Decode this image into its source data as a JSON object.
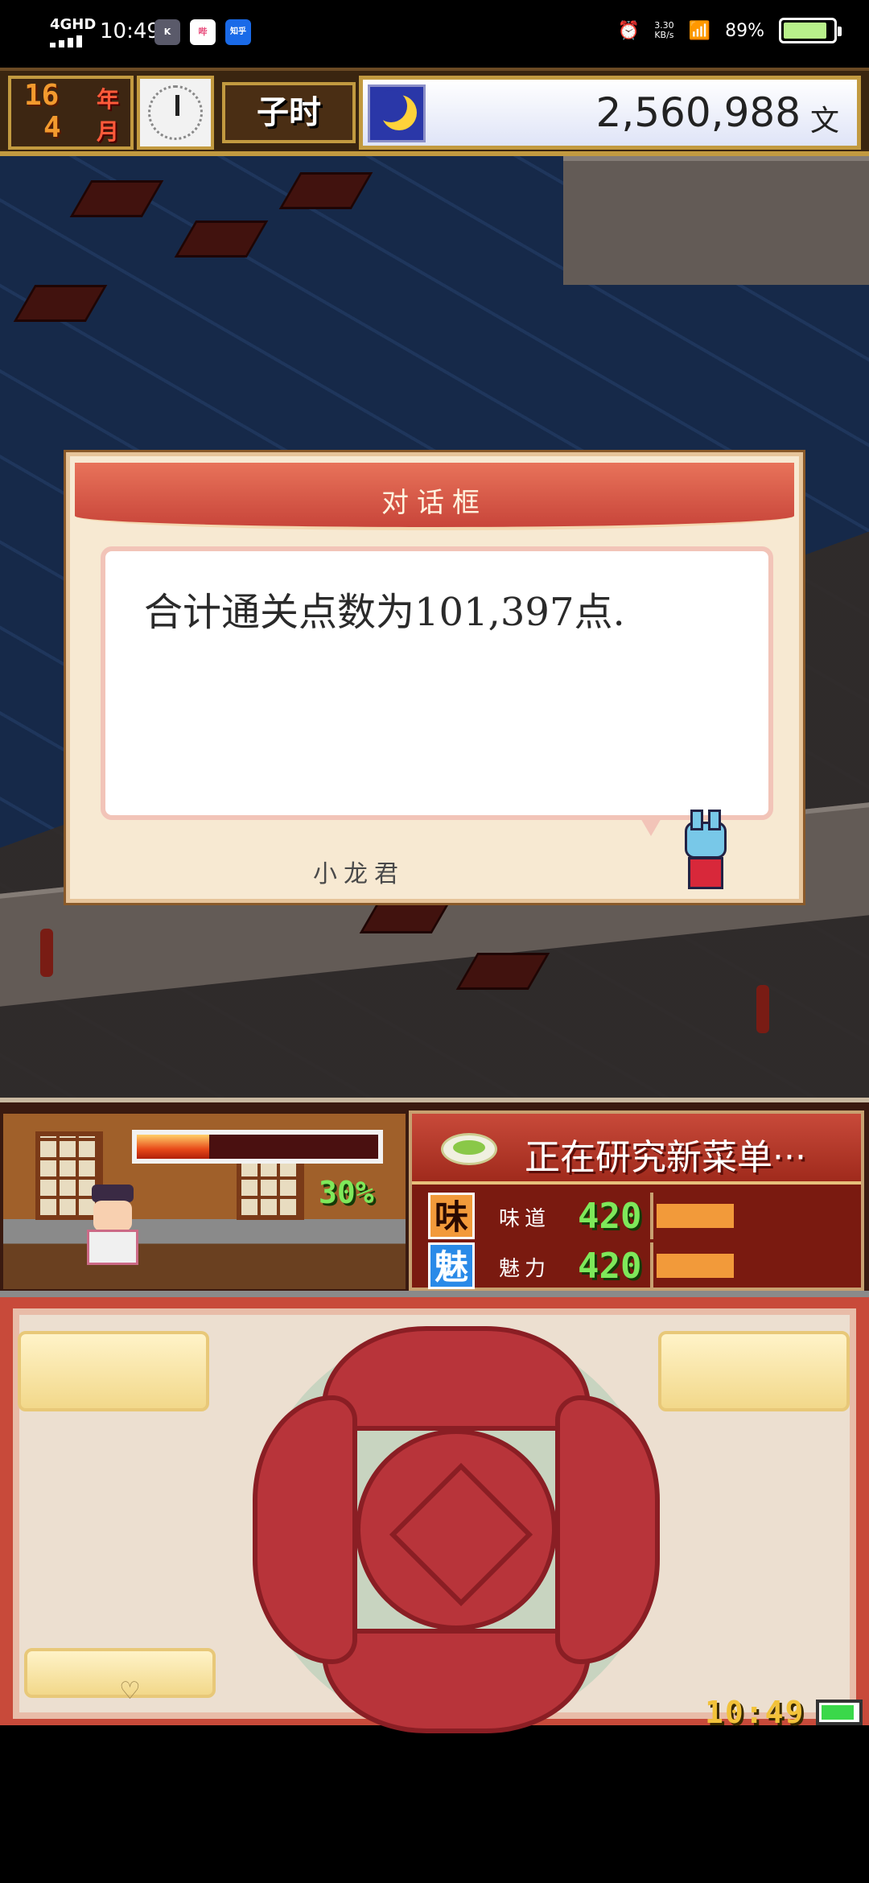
{
  "status_bar": {
    "network": "4GHD",
    "time": "10:49",
    "apps": [
      "K",
      "哔",
      "知乎"
    ],
    "net_speed_value": "3.30",
    "net_speed_unit": "KB/s",
    "battery_percent": "89%",
    "battery_level": 0.89
  },
  "hud": {
    "year_num": "16",
    "year_unit": "年",
    "month_num": "4",
    "month_unit": "月",
    "period": "子时",
    "money": "2,560,988",
    "money_unit": "文",
    "icons": [
      "clock-icon",
      "moon-icon"
    ]
  },
  "dialog": {
    "title": "对话框",
    "message": "合计通关点数为101,397点.",
    "speaker": "小龙君"
  },
  "kitchen": {
    "progress_percent": "30%",
    "progress_fraction": 0.3,
    "research_title": "正在研究新菜单···",
    "stats": [
      {
        "badge": "味",
        "name": "味道",
        "value": "420",
        "level": 0.5,
        "badge_bg": "#f29a3a",
        "badge_color": "#2a0a00"
      },
      {
        "badge": "魅",
        "name": "魅力",
        "value": "420",
        "level": 0.5,
        "badge_bg": "#2a8ae8",
        "badge_color": "#ffffff"
      }
    ]
  },
  "controls": {
    "clock": "10:49",
    "battery_level": 0.9
  },
  "colors": {
    "accent_red": "#c84a3a",
    "gold": "#c29a40",
    "green_digits": "#7ee85a"
  }
}
